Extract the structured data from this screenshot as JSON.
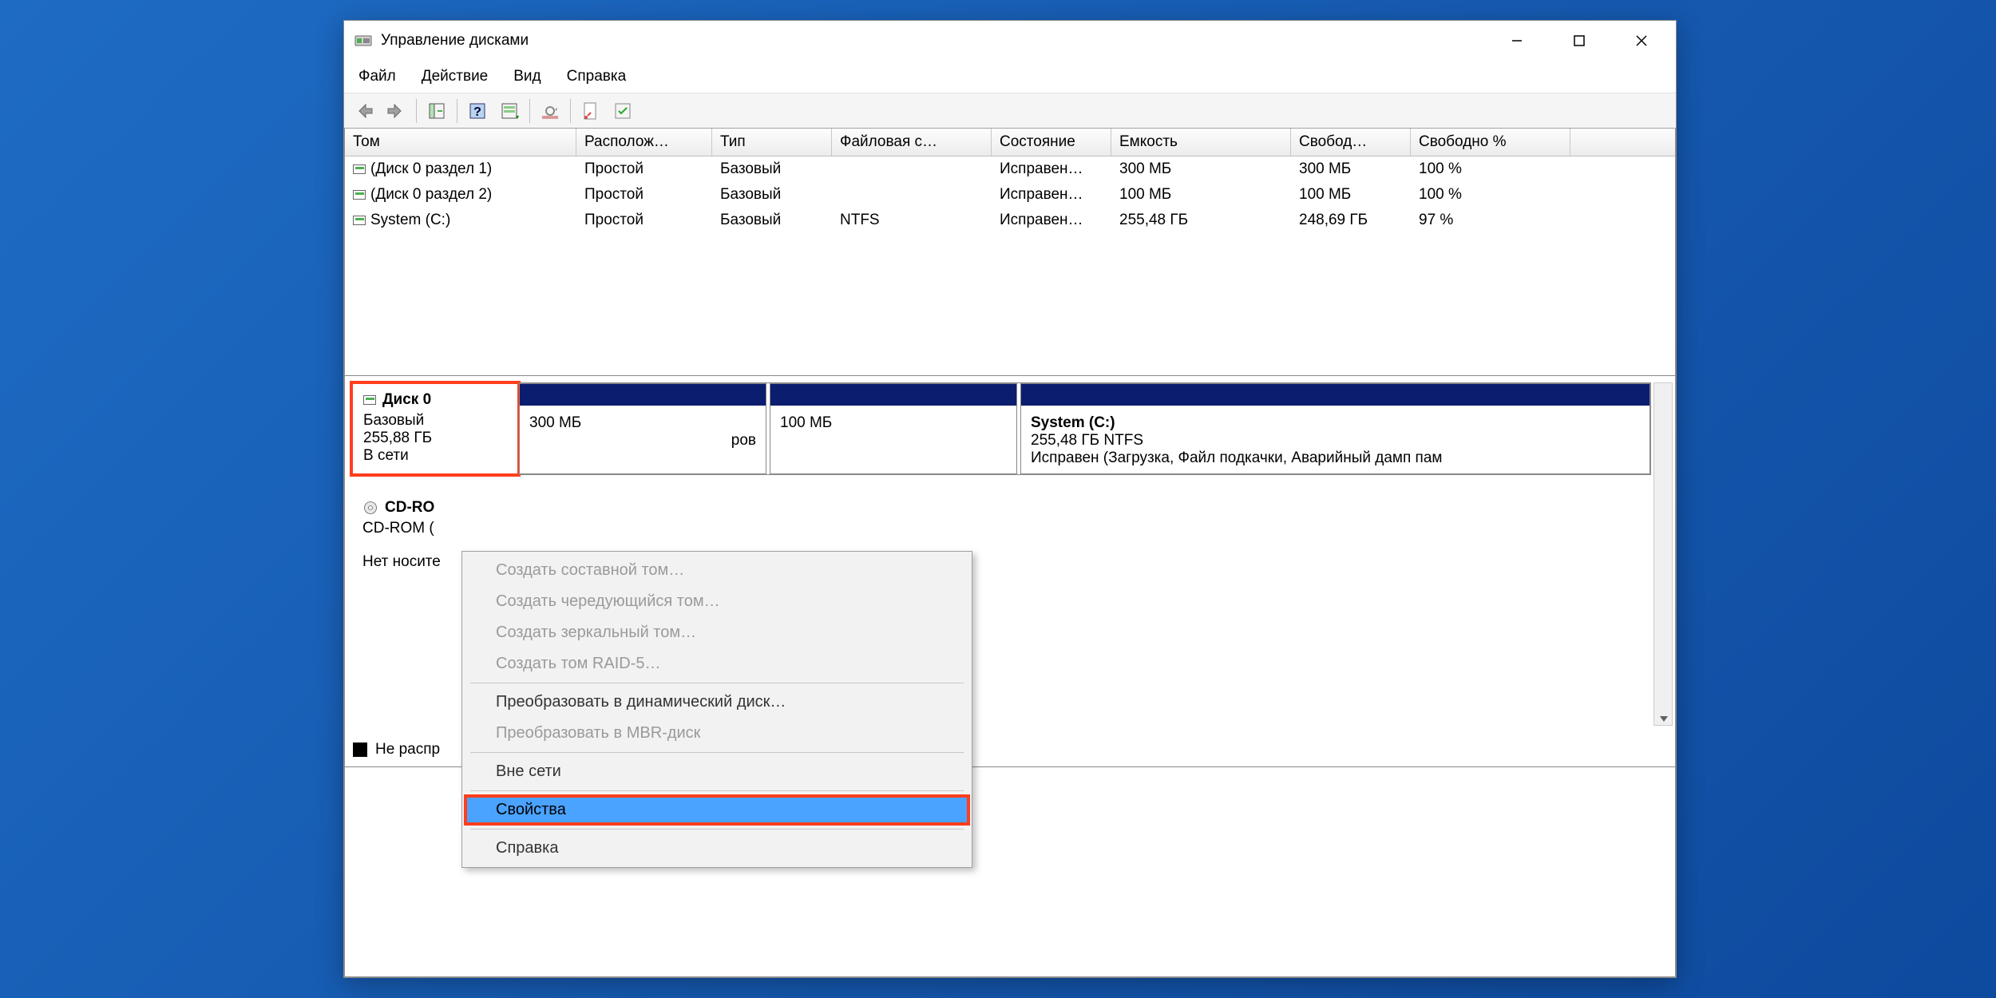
{
  "window": {
    "title": "Управление дисками"
  },
  "menu": {
    "file": "Файл",
    "action": "Действие",
    "view": "Вид",
    "help": "Справка"
  },
  "columns": [
    "Том",
    "Располож…",
    "Тип",
    "Файловая с…",
    "Состояние",
    "Емкость",
    "Свобод…",
    "Свободно %"
  ],
  "volumes": [
    {
      "name": "(Диск 0 раздел 1)",
      "layout": "Простой",
      "type": "Базовый",
      "fs": "",
      "status": "Исправен…",
      "cap": "300 МБ",
      "free": "300 МБ",
      "pct": "100 %"
    },
    {
      "name": "(Диск 0 раздел 2)",
      "layout": "Простой",
      "type": "Базовый",
      "fs": "",
      "status": "Исправен…",
      "cap": "100 МБ",
      "free": "100 МБ",
      "pct": "100 %"
    },
    {
      "name": "System (C:)",
      "layout": "Простой",
      "type": "Базовый",
      "fs": "NTFS",
      "status": "Исправен…",
      "cap": "255,48 ГБ",
      "free": "248,69 ГБ",
      "pct": "97 %"
    }
  ],
  "disk0": {
    "title": "Диск 0",
    "type": "Базовый",
    "size": "255,88 ГБ",
    "status": "В сети",
    "parts": [
      {
        "size": "300 МБ",
        "rest": "ров"
      },
      {
        "size": "100 МБ"
      },
      {
        "title": "System  (C:)",
        "line1": "255,48 ГБ NTFS",
        "line2": "Исправен (Загрузка, Файл подкачки, Аварийный дамп пам"
      }
    ]
  },
  "cdrom": {
    "title": "CD-RO",
    "line1": "CD-ROM (",
    "line2": "Нет носите"
  },
  "legend": {
    "label": "Не распр"
  },
  "ctx": {
    "spanned": "Создать составной том…",
    "striped": "Создать чередующийся том…",
    "mirror": "Создать зеркальный том…",
    "raid": "Создать том RAID-5…",
    "dyn": "Преобразовать в динамический диск…",
    "mbr": "Преобразовать в MBR-диск",
    "offline": "Вне сети",
    "props": "Свойства",
    "help": "Справка"
  }
}
